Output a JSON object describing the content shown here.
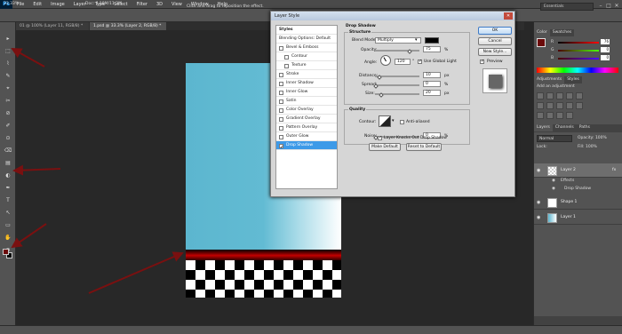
{
  "app": {
    "logo": "Ps"
  },
  "menu": [
    "File",
    "Edit",
    "Image",
    "Layer",
    "Type",
    "Select",
    "Filter",
    "3D",
    "View",
    "Window",
    "Help"
  ],
  "options_bar": {
    "hint": "Click and drag to reposition the effect.",
    "workspace": "Essentials"
  },
  "window_controls": [
    "–",
    "□",
    "✕"
  ],
  "doc_tabs": [
    {
      "label": "01 @ 100% (Layer 11, RGB/8) *",
      "active": false
    },
    {
      "label": "1.psd @ 33.3% (Layer 2, RGB/8) *",
      "active": true
    }
  ],
  "tools": [
    "▸",
    "⬚",
    "⌇",
    "✎",
    "⌖",
    "✂",
    "⊘",
    "✐",
    "⊙",
    "⌫",
    "▤",
    "◐",
    "✒",
    "T",
    "↖",
    "▭",
    "✋",
    "⊕"
  ],
  "status": {
    "zoom": "33.33%",
    "doc": "Doc: 6.18M/11.3M"
  },
  "color_panel": {
    "tabs": [
      "Color",
      "Swatches"
    ],
    "sliders": [
      {
        "label": "R",
        "value": "76"
      },
      {
        "label": "G",
        "value": "0"
      },
      {
        "label": "B",
        "value": "0"
      }
    ],
    "fg": "#6b0a0a"
  },
  "adjustments": {
    "tabs": [
      "Adjustments",
      "Styles"
    ],
    "title": "Add an adjustment"
  },
  "layers": {
    "tabs": [
      "Layers",
      "Channels",
      "Paths"
    ],
    "kind": "Kind",
    "blend": "Normal",
    "opacity_label": "Opacity:",
    "opacity": "100%",
    "lock_label": "Lock:",
    "fill_label": "Fill:",
    "fill": "100%",
    "rows": [
      {
        "name": "Layer 2",
        "selected": true,
        "fx": "fx"
      },
      {
        "name": "Shape 1",
        "selected": false,
        "fx": ""
      },
      {
        "name": "Layer 1",
        "selected": false,
        "fx": ""
      }
    ],
    "effects_label": "Effects",
    "effect_item": "Drop Shadow"
  },
  "dialog": {
    "title": "Layer Style",
    "styles_header": "Styles",
    "styles": [
      {
        "label": "Blending Options: Default",
        "checkbox": false,
        "selected": false
      },
      {
        "label": "Bevel & Emboss",
        "checkbox": true,
        "selected": false
      },
      {
        "label": "Contour",
        "checkbox": true,
        "selected": false,
        "indent": true
      },
      {
        "label": "Texture",
        "checkbox": true,
        "selected": false,
        "indent": true
      },
      {
        "label": "Stroke",
        "checkbox": true,
        "selected": false
      },
      {
        "label": "Inner Shadow",
        "checkbox": true,
        "selected": false
      },
      {
        "label": "Inner Glow",
        "checkbox": true,
        "selected": false
      },
      {
        "label": "Satin",
        "checkbox": true,
        "selected": false
      },
      {
        "label": "Color Overlay",
        "checkbox": true,
        "selected": false
      },
      {
        "label": "Gradient Overlay",
        "checkbox": true,
        "selected": false
      },
      {
        "label": "Pattern Overlay",
        "checkbox": true,
        "selected": false
      },
      {
        "label": "Outer Glow",
        "checkbox": true,
        "selected": false
      },
      {
        "label": "Drop Shadow",
        "checkbox": true,
        "selected": true
      }
    ],
    "section_title": "Drop Shadow",
    "structure_title": "Structure",
    "blend_mode_label": "Blend Mode:",
    "blend_mode": "Multiply",
    "shadow_color": "#000000",
    "opacity_label": "Opacity:",
    "opacity": "75",
    "angle_label": "Angle:",
    "angle": "120",
    "global_light": "Use Global Light",
    "distance_label": "Distance:",
    "distance": "10",
    "spread_label": "Spread:",
    "spread": "0",
    "size_label": "Size:",
    "size": "20",
    "quality_title": "Quality",
    "contour_label": "Contour:",
    "anti_aliased": "Anti-aliased",
    "noise_label": "Noise:",
    "noise": "0",
    "layer_knocks": "Layer Knocks Out Drop Shadow",
    "make_default": "Make Default",
    "reset_default": "Reset to Default",
    "unit_percent": "%",
    "unit_px": "px",
    "unit_deg": "°",
    "ok": "OK",
    "cancel": "Cancel",
    "new_style": "New Style...",
    "preview": "Preview"
  }
}
